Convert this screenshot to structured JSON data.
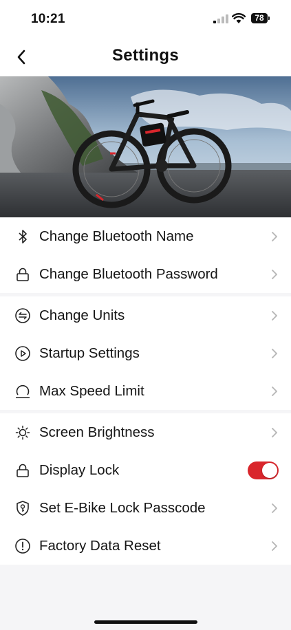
{
  "status_bar": {
    "time": "10:21",
    "battery": "78"
  },
  "header": {
    "title": "Settings",
    "back_icon": "chevron-left-icon"
  },
  "colors": {
    "accent": "#d9262c",
    "background": "#f5f5f7",
    "row_bg": "#ffffff",
    "text": "#161616",
    "chevron": "#b5b5b5"
  },
  "hero": {
    "image_alt": "black e-bike with red accents on a waterfront road"
  },
  "groups": [
    {
      "items": [
        {
          "label": "Change Bluetooth Name",
          "icon": "bluetooth-icon",
          "control": "chevron"
        },
        {
          "label": "Change Bluetooth Password",
          "icon": "lock-icon",
          "control": "chevron"
        }
      ]
    },
    {
      "items": [
        {
          "label": "Change Units",
          "icon": "swap-arrows-icon",
          "control": "chevron"
        },
        {
          "label": "Startup Settings",
          "icon": "play-circle-icon",
          "control": "chevron"
        },
        {
          "label": "Max Speed Limit",
          "icon": "speed-limit-icon",
          "control": "chevron"
        }
      ]
    },
    {
      "items": [
        {
          "label": "Screen Brightness",
          "icon": "sun-icon",
          "control": "chevron"
        },
        {
          "label": "Display Lock",
          "icon": "lock-icon",
          "control": "toggle",
          "toggle_on": true
        },
        {
          "label": "Set E-Bike Lock Passcode",
          "icon": "shield-key-icon",
          "control": "chevron"
        },
        {
          "label": "Factory Data Reset",
          "icon": "alert-circle-icon",
          "control": "chevron"
        }
      ]
    }
  ]
}
